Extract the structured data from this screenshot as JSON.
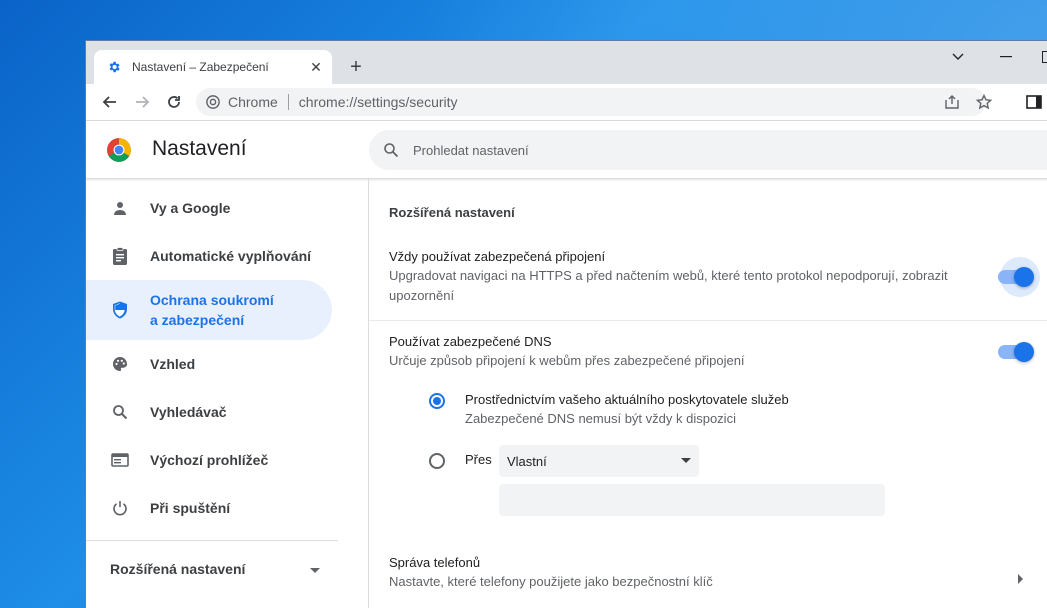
{
  "tab": {
    "title": "Nastavení – Zabezpečení",
    "close": "✕",
    "new_tab": "+"
  },
  "window_controls": {
    "minimize_chevron": "⌵",
    "minimize": "—"
  },
  "omnibox": {
    "site_chip": "Chrome",
    "url": "chrome://settings/security"
  },
  "header": {
    "title": "Nastavení",
    "search_placeholder": "Prohledat nastavení"
  },
  "sidebar": {
    "items": [
      {
        "label": "Vy a Google",
        "icon": "person-icon"
      },
      {
        "label": "Automatické vyplňování",
        "icon": "clipboard-icon"
      },
      {
        "label": "Ochrana soukromí a zabezpečení",
        "line1": "Ochrana soukromí",
        "line2": "a zabezpečení",
        "icon": "shield-icon",
        "active": true
      },
      {
        "label": "Vzhled",
        "icon": "palette-icon"
      },
      {
        "label": "Vyhledávač",
        "icon": "search-icon"
      },
      {
        "label": "Výchozí prohlížeč",
        "icon": "browser-icon"
      },
      {
        "label": "Při spuštění",
        "icon": "power-icon"
      }
    ],
    "advanced": "Rozšířená nastavení"
  },
  "content": {
    "section_title": "Rozšířená nastavení",
    "https": {
      "title": "Vždy používat zabezpečená připojení",
      "desc_line1": "Upgradovat navigaci na HTTPS a před načtením webů, které tento protokol nepodporují, zobrazit",
      "desc_line2": "upozornění",
      "enabled": true
    },
    "dns": {
      "title": "Používat zabezpečené DNS",
      "desc": "Určuje způsob připojení k webům přes zabezpečené připojení",
      "enabled": true,
      "option_current": {
        "title": "Prostřednictvím vašeho aktuálního poskytovatele služeb",
        "desc": "Zabezpečené DNS nemusí být vždy k dispozici",
        "selected": true
      },
      "option_custom": {
        "label": "Přes",
        "select_value": "Vlastní",
        "selected": false,
        "input_value": ""
      }
    },
    "phones": {
      "title": "Správa telefonů",
      "desc": "Nastavte, které telefony použijete jako bezpečnostní klíč"
    }
  },
  "colors": {
    "accent": "#1a73e8",
    "active_bg": "#e8f0fe",
    "toggle_track": "#8ab4f8"
  }
}
